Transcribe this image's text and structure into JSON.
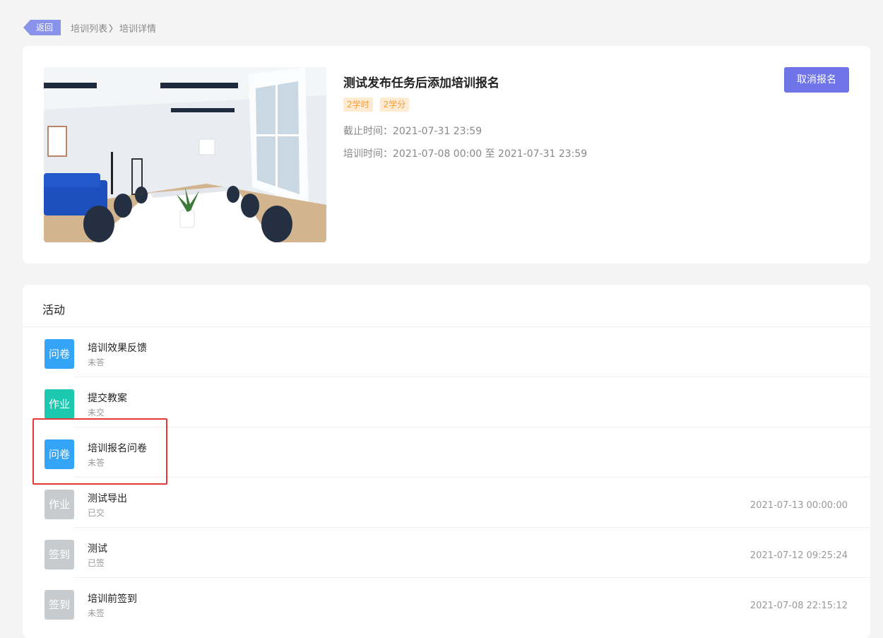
{
  "nav": {
    "back_label": "返回",
    "crumb_1": "培训列表",
    "crumb_sep": "〉",
    "crumb_2": "培训详情"
  },
  "training": {
    "title": "测试发布任务后添加培训报名",
    "tags": [
      "2学时",
      "2学分"
    ],
    "deadline": "截止时间：2021-07-31 23:59",
    "period": "培训时间：2021-07-08 00:00 至 2021-07-31 23:59",
    "cancel_label": "取消报名"
  },
  "activities": {
    "heading": "活动",
    "items": [
      {
        "badge": "问卷",
        "name": "培训效果反馈",
        "status": "未答",
        "time": ""
      },
      {
        "badge": "作业",
        "name": "提交教案",
        "status": "未交",
        "time": ""
      },
      {
        "badge": "问卷",
        "name": "培训报名问卷",
        "status": "未答",
        "time": ""
      },
      {
        "badge": "作业",
        "name": "测试导出",
        "status": "已交",
        "time": "2021-07-13 00:00:00"
      },
      {
        "badge": "签到",
        "name": "测试",
        "status": "已签",
        "time": "2021-07-12 09:25:24"
      },
      {
        "badge": "签到",
        "name": "培训前签到",
        "status": "未签",
        "time": "2021-07-08 22:15:12"
      }
    ]
  },
  "colors": {
    "accent": "#6f74e6",
    "questionnaire": "#34a4f6",
    "homework": "#1dc8b0",
    "done": "#c8cbce",
    "highlight": "#e53935"
  }
}
